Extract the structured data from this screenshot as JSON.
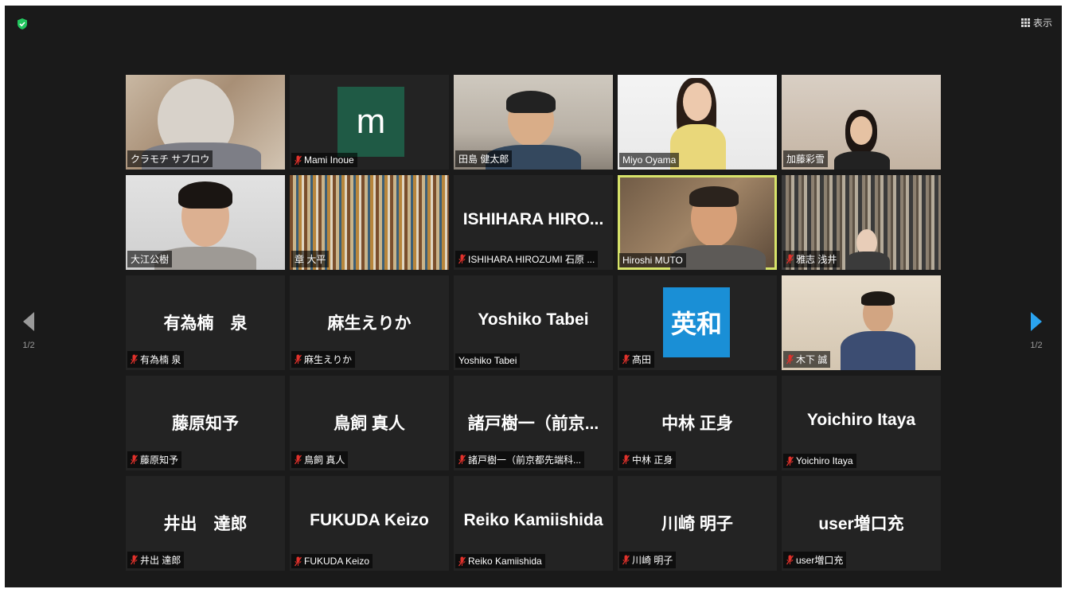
{
  "toolbar": {
    "view_label": "表示"
  },
  "pagination": {
    "left_page": "1/2",
    "right_page": "1/2"
  },
  "colors": {
    "active_speaker": "#d7e36a",
    "mic_muted": "#e0312b",
    "shield": "#22c55e"
  },
  "tiles": [
    {
      "name": "クラモチ サブロウ",
      "big": "",
      "muted": false,
      "kind": "video"
    },
    {
      "name": "Mami Inoue",
      "big": "",
      "muted": true,
      "kind": "avatar",
      "avatar": "m"
    },
    {
      "name": "田島 健太郎",
      "big": "",
      "muted": false,
      "kind": "video"
    },
    {
      "name": "Miyo Oyama",
      "big": "",
      "muted": false,
      "kind": "video"
    },
    {
      "name": "加藤彩雪",
      "big": "",
      "muted": false,
      "kind": "video"
    },
    {
      "name": "大江公樹",
      "big": "",
      "muted": false,
      "kind": "video"
    },
    {
      "name": "章 大平",
      "big": "",
      "muted": false,
      "kind": "video"
    },
    {
      "name": "ISHIHARA HIROZUMI 石原 ...",
      "big": "ISHIHARA HIRO...",
      "muted": true,
      "kind": "name"
    },
    {
      "name": "Hiroshi MUTO",
      "big": "",
      "muted": false,
      "kind": "video",
      "active": true
    },
    {
      "name": "雅志 浅井",
      "big": "",
      "muted": true,
      "kind": "video"
    },
    {
      "name": "有為楠 泉",
      "big": "有為楠　泉",
      "muted": true,
      "kind": "name"
    },
    {
      "name": "麻生えりか",
      "big": "麻生えりか",
      "muted": true,
      "kind": "name"
    },
    {
      "name": "Yoshiko Tabei",
      "big": "Yoshiko Tabei",
      "muted": false,
      "kind": "name"
    },
    {
      "name": "髙田",
      "big": "",
      "muted": true,
      "kind": "avatar",
      "avatar": "英和"
    },
    {
      "name": "木下 誠",
      "big": "",
      "muted": true,
      "kind": "video"
    },
    {
      "name": "藤原知予",
      "big": "藤原知予",
      "muted": true,
      "kind": "name"
    },
    {
      "name": "鳥飼 真人",
      "big": "鳥飼 真人",
      "muted": true,
      "kind": "name"
    },
    {
      "name": "諸戸樹一（前京都先端科...",
      "big": "諸戸樹一（前京...",
      "muted": true,
      "kind": "name"
    },
    {
      "name": "中林 正身",
      "big": "中林 正身",
      "muted": true,
      "kind": "name"
    },
    {
      "name": "Yoichiro Itaya",
      "big": "Yoichiro Itaya",
      "muted": true,
      "kind": "name"
    },
    {
      "name": "井出 達郎",
      "big": "井出　達郎",
      "muted": true,
      "kind": "name"
    },
    {
      "name": "FUKUDA Keizo",
      "big": "FUKUDA Keizo",
      "muted": true,
      "kind": "name"
    },
    {
      "name": "Reiko Kamiishida",
      "big": "Reiko Kamiishida",
      "muted": true,
      "kind": "name"
    },
    {
      "name": "川崎 明子",
      "big": "川崎 明子",
      "muted": true,
      "kind": "name"
    },
    {
      "name": "user増口充",
      "big": "user増口充",
      "muted": true,
      "kind": "name"
    }
  ]
}
